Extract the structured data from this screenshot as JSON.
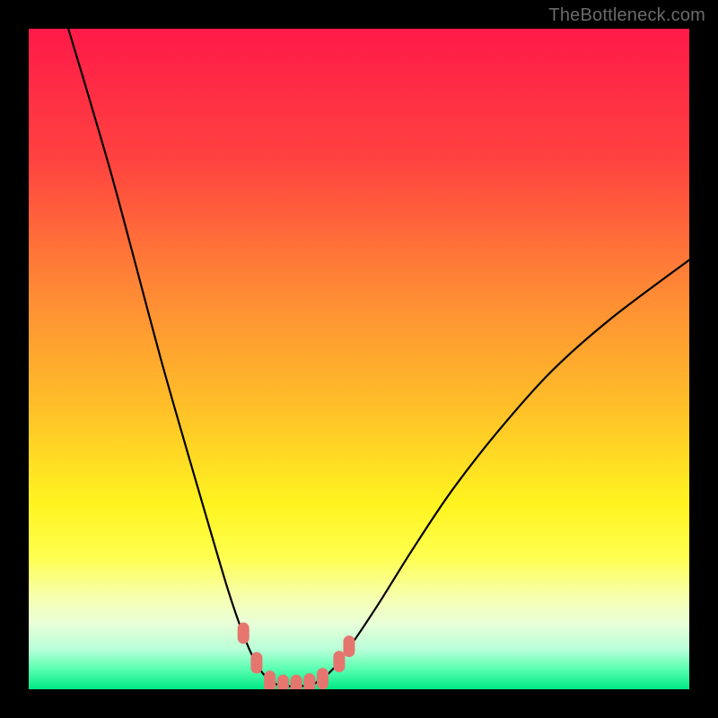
{
  "watermark": "TheBottleneck.com",
  "chart_data": {
    "type": "line",
    "title": "",
    "xlabel": "",
    "ylabel": "",
    "xlim": [
      0,
      100
    ],
    "ylim": [
      0,
      100
    ],
    "background_gradient": {
      "stops": [
        {
          "pos": 0.0,
          "color": "#ff1a49"
        },
        {
          "pos": 0.2,
          "color": "#ff4340"
        },
        {
          "pos": 0.4,
          "color": "#ff8a35"
        },
        {
          "pos": 0.58,
          "color": "#ffc228"
        },
        {
          "pos": 0.72,
          "color": "#fff420"
        },
        {
          "pos": 0.8,
          "color": "#ffff50"
        },
        {
          "pos": 0.86,
          "color": "#f7ffae"
        },
        {
          "pos": 0.9,
          "color": "#e9ffd8"
        },
        {
          "pos": 0.94,
          "color": "#b8ffd8"
        },
        {
          "pos": 0.97,
          "color": "#58ffb0"
        },
        {
          "pos": 1.0,
          "color": "#00e884"
        }
      ]
    },
    "series": [
      {
        "name": "bottleneck-curve",
        "color": "#000000",
        "points": [
          {
            "x": 6.0,
            "y": 100.0
          },
          {
            "x": 9.0,
            "y": 90.0
          },
          {
            "x": 12.5,
            "y": 78.0
          },
          {
            "x": 16.0,
            "y": 65.0
          },
          {
            "x": 20.0,
            "y": 50.0
          },
          {
            "x": 24.0,
            "y": 36.0
          },
          {
            "x": 27.5,
            "y": 24.0
          },
          {
            "x": 30.5,
            "y": 14.0
          },
          {
            "x": 33.0,
            "y": 7.0
          },
          {
            "x": 35.0,
            "y": 3.0
          },
          {
            "x": 37.0,
            "y": 1.0
          },
          {
            "x": 39.0,
            "y": 0.5
          },
          {
            "x": 41.5,
            "y": 0.5
          },
          {
            "x": 43.5,
            "y": 1.0
          },
          {
            "x": 46.0,
            "y": 3.0
          },
          {
            "x": 49.0,
            "y": 7.0
          },
          {
            "x": 53.0,
            "y": 13.0
          },
          {
            "x": 58.0,
            "y": 21.0
          },
          {
            "x": 64.0,
            "y": 30.0
          },
          {
            "x": 71.0,
            "y": 39.0
          },
          {
            "x": 79.0,
            "y": 48.0
          },
          {
            "x": 88.0,
            "y": 56.0
          },
          {
            "x": 100.0,
            "y": 65.0
          }
        ]
      },
      {
        "name": "highlight-markers",
        "color": "#e5766f",
        "points": [
          {
            "x": 32.5,
            "y": 8.5
          },
          {
            "x": 34.5,
            "y": 4.0
          },
          {
            "x": 36.5,
            "y": 1.2
          },
          {
            "x": 38.5,
            "y": 0.6
          },
          {
            "x": 40.5,
            "y": 0.6
          },
          {
            "x": 42.5,
            "y": 0.8
          },
          {
            "x": 44.5,
            "y": 1.6
          },
          {
            "x": 47.0,
            "y": 4.2
          },
          {
            "x": 48.5,
            "y": 6.5
          }
        ]
      }
    ]
  }
}
